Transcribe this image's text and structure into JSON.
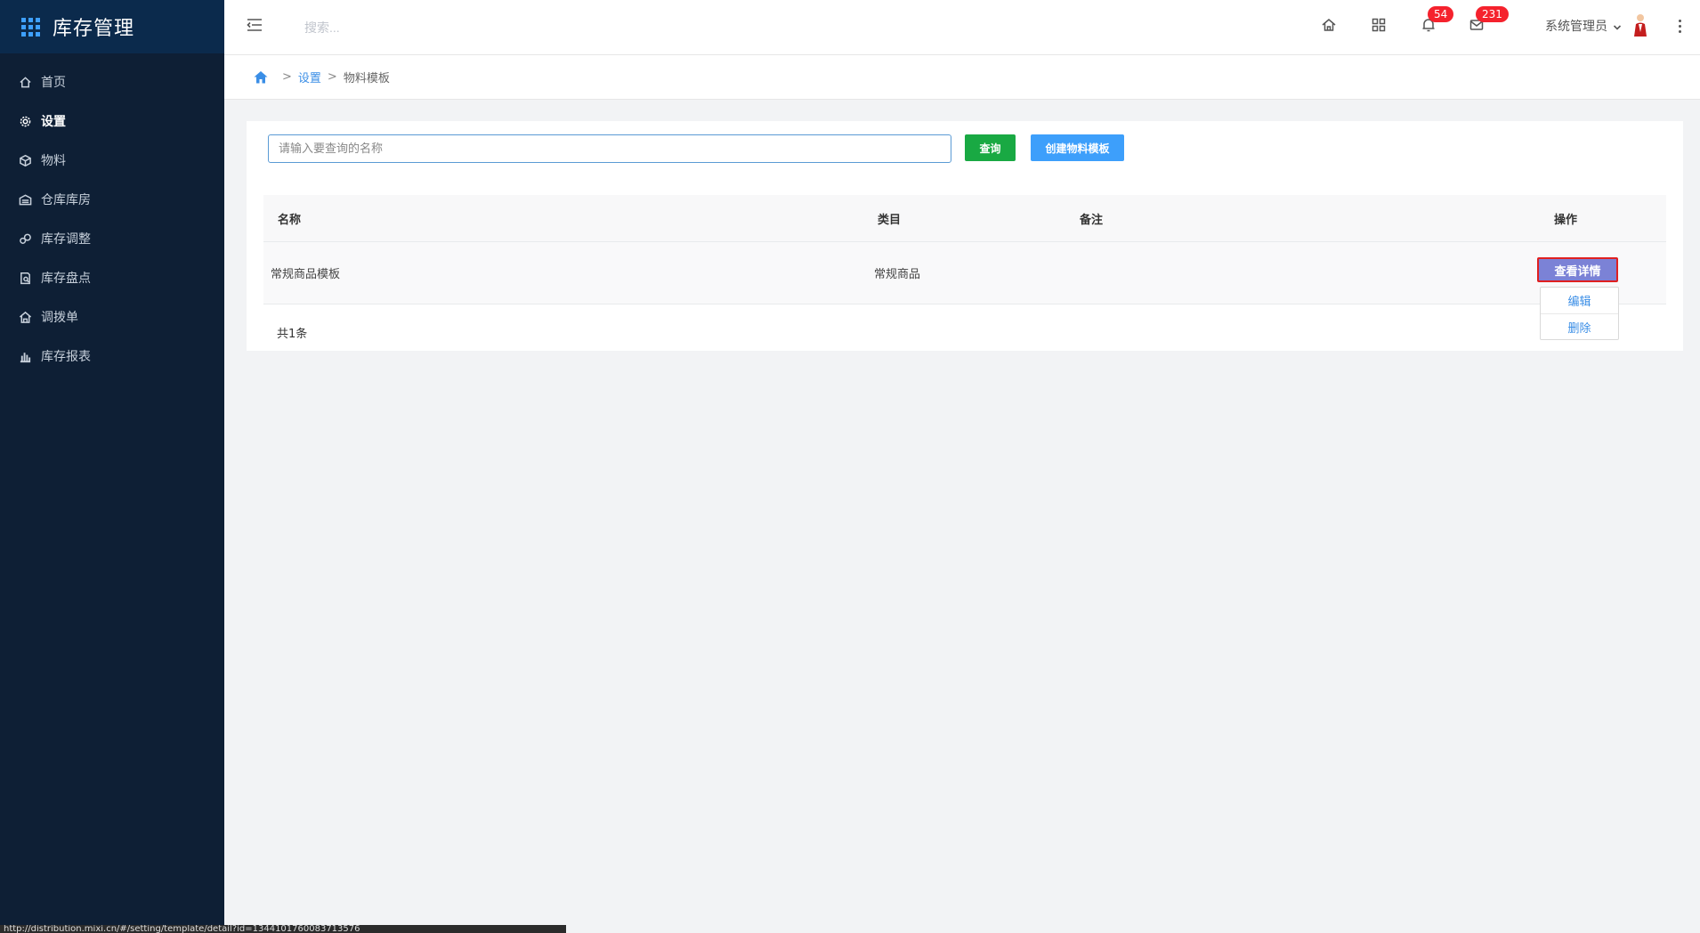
{
  "app": {
    "title": "库存管理"
  },
  "sidebar": {
    "items": [
      {
        "label": "首页",
        "icon": "home-icon"
      },
      {
        "label": "设置",
        "icon": "gear-icon",
        "active": true
      },
      {
        "label": "物料",
        "icon": "cube-icon"
      },
      {
        "label": "仓库库房",
        "icon": "warehouse-icon"
      },
      {
        "label": "库存调整",
        "icon": "adjust-icon"
      },
      {
        "label": "库存盘点",
        "icon": "inventory-check-icon"
      },
      {
        "label": "调拨单",
        "icon": "transfer-icon"
      },
      {
        "label": "库存报表",
        "icon": "bar-chart-icon"
      }
    ]
  },
  "header": {
    "search_placeholder": "搜索...",
    "notifications_count": "54",
    "messages_count": "231",
    "user_name": "系统管理员"
  },
  "breadcrumb": {
    "items": [
      "设置",
      "物料模板"
    ],
    "separator": ">"
  },
  "toolbar": {
    "query_placeholder": "请输入要查询的名称",
    "query_label": "查询",
    "create_label": "创建物料模板"
  },
  "table": {
    "columns": [
      "名称",
      "类目",
      "备注",
      "操作"
    ],
    "rows": [
      {
        "name": "常规商品模板",
        "category": "常规商品",
        "note": ""
      }
    ],
    "actions": {
      "detail": "查看详情",
      "edit": "编辑",
      "delete": "删除"
    }
  },
  "pagination": {
    "total_text": "共1条"
  },
  "status_bar": {
    "text": "http://distribution.mixi.cn/#/setting/template/detail?id=1344101760083713576"
  },
  "colors": {
    "sidebar_bg": "#0e1f35",
    "brand_bg": "#0b2a4c",
    "query_button": "#19a943",
    "create_button": "#3d9ffb",
    "detail_button": "#7b82d6",
    "badge": "#f5222d",
    "link": "#3a8ee6"
  }
}
